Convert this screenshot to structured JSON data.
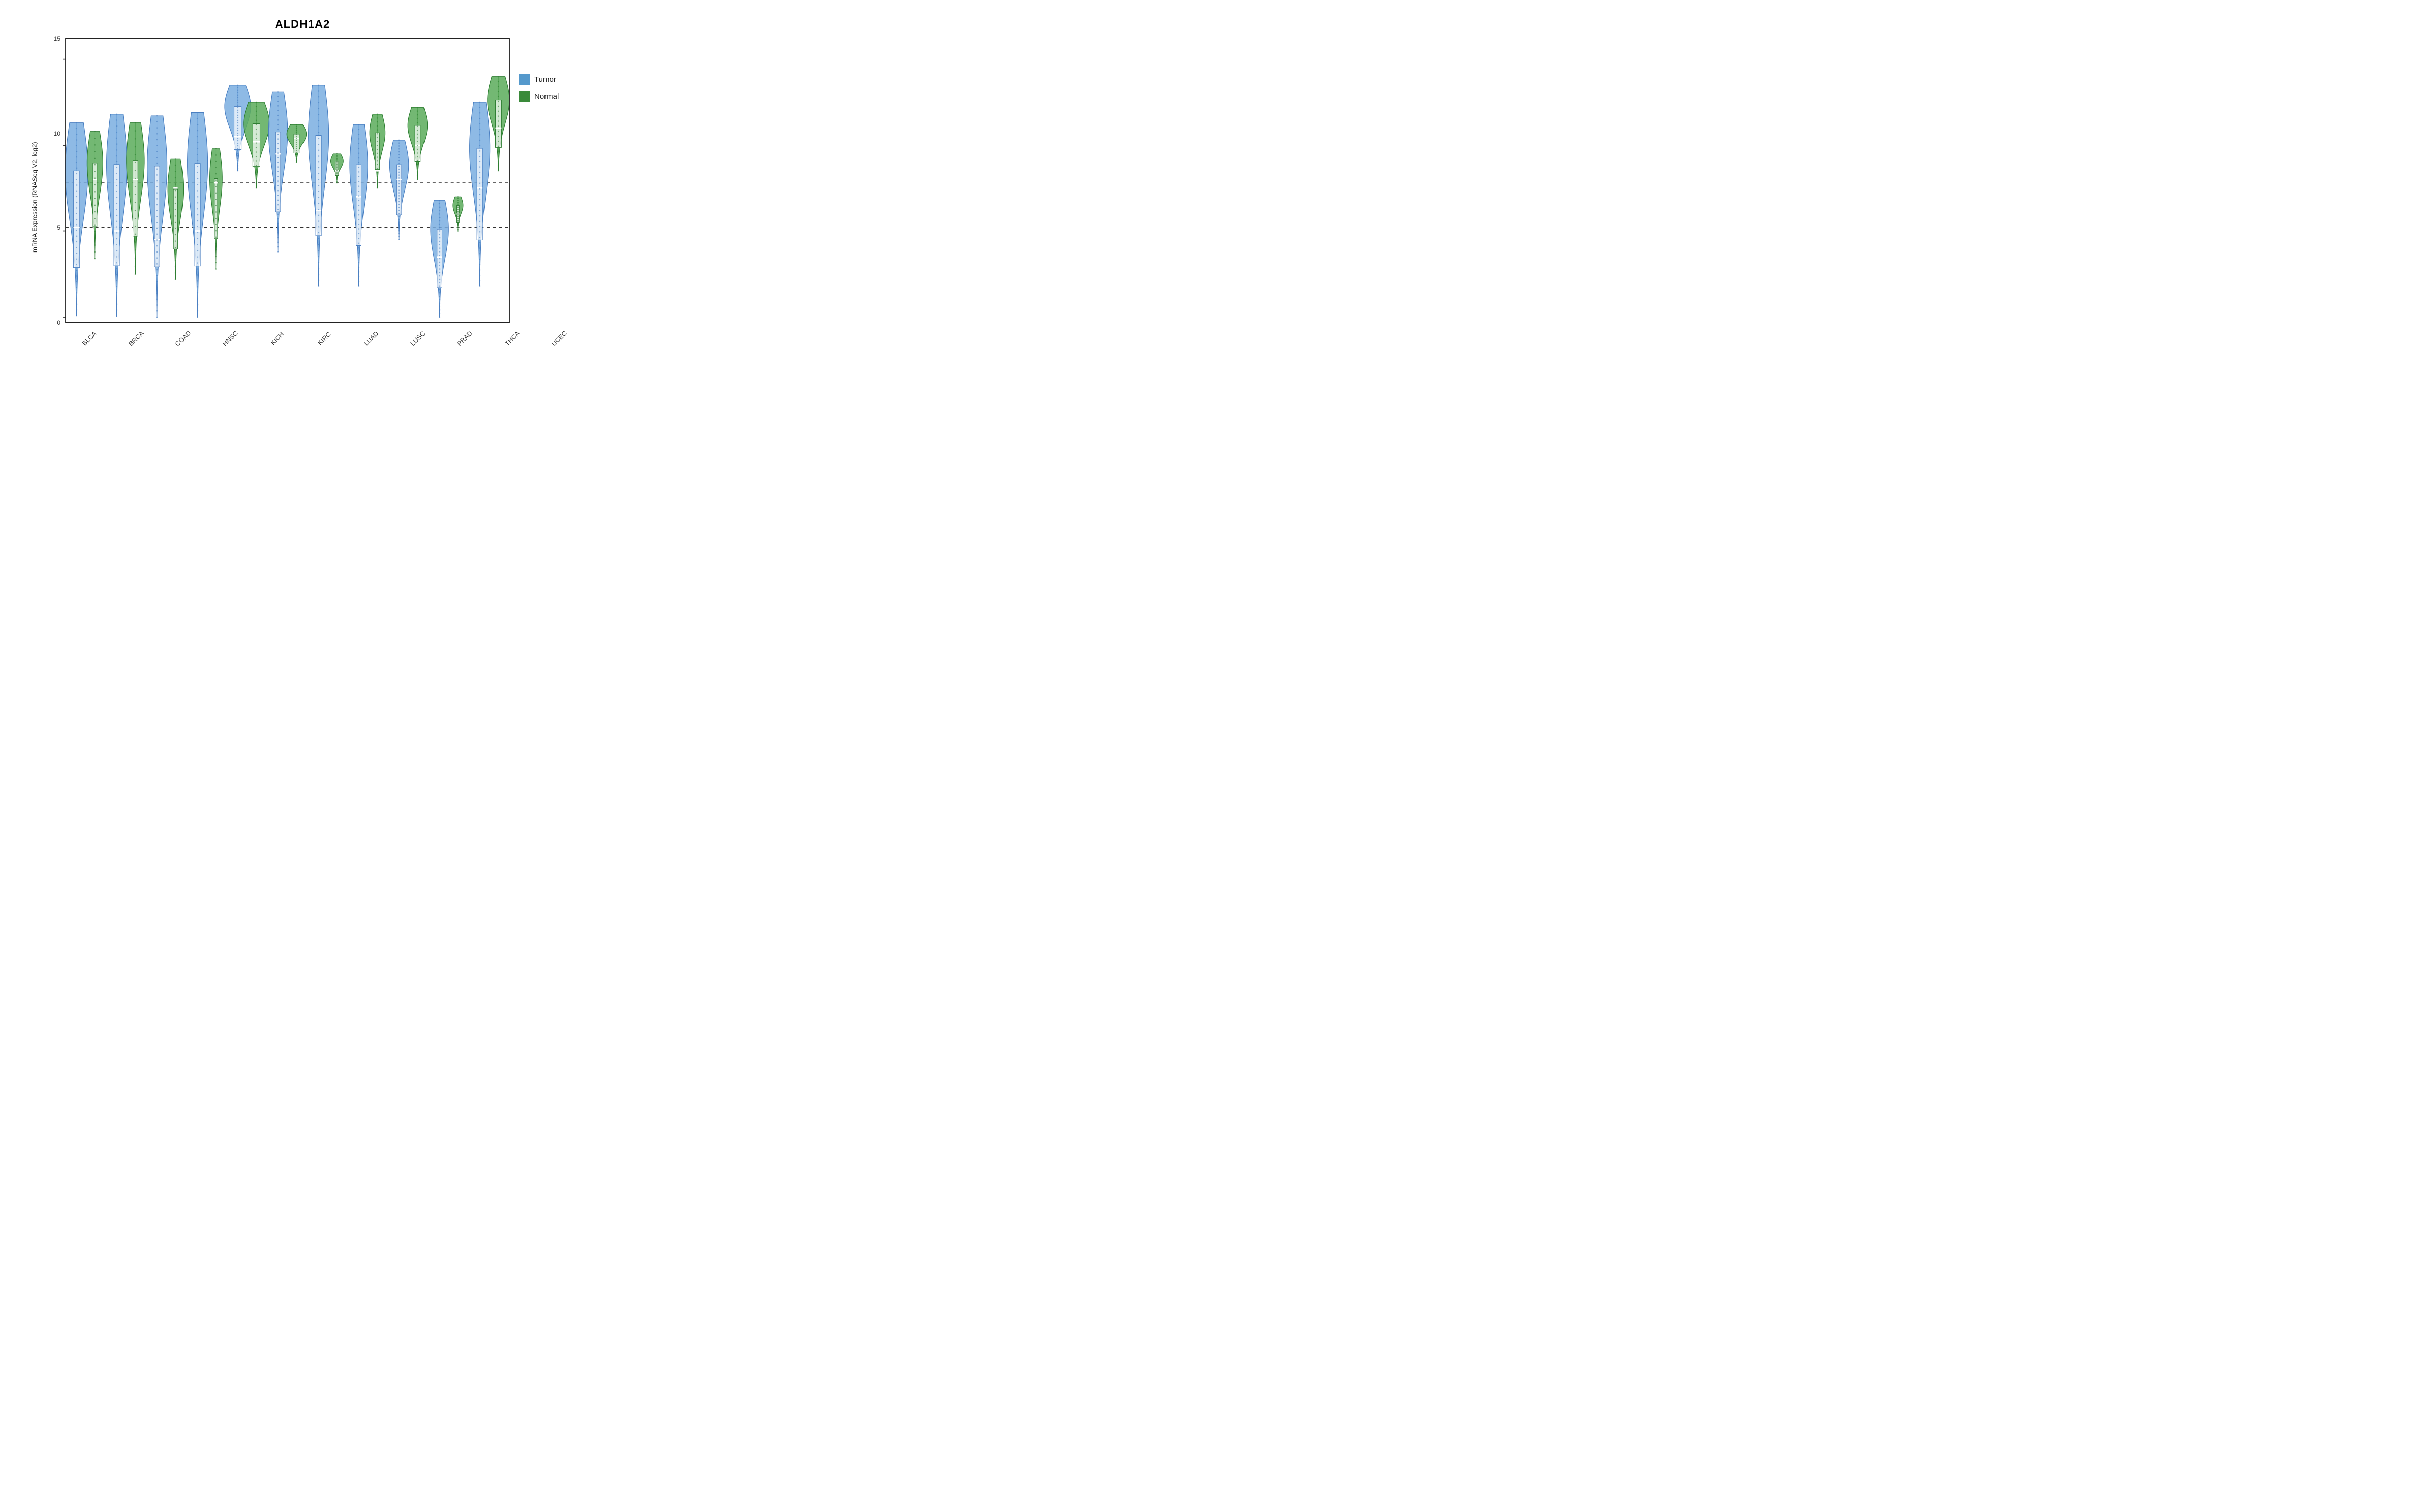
{
  "title": "ALDH1A2",
  "y_axis_label": "mRNA Expression (RNASeq V2, log2)",
  "y_ticks": [
    "15",
    "10",
    "5",
    "0"
  ],
  "x_labels": [
    "BLCA",
    "BRCA",
    "COAD",
    "HNSC",
    "KICH",
    "KIRC",
    "LUAD",
    "LUSC",
    "PRAD",
    "THCA",
    "UCEC"
  ],
  "dashed_lines_y": [
    7.8,
    5.2
  ],
  "legend": [
    {
      "label": "Tumor",
      "color": "#4a90d9"
    },
    {
      "label": "Normal",
      "color": "#4a9a3a"
    }
  ],
  "colors": {
    "tumor": "#5599cc",
    "tumor_fill": "#7bb8e8",
    "normal": "#3a8a3a",
    "normal_fill": "#5aaa5a",
    "dashed": "#333333",
    "axis": "#222222",
    "border": "#222222"
  },
  "violins": [
    {
      "name": "BLCA",
      "tumor": {
        "cx": 0.5,
        "ymin": 0.02,
        "ymax": 11.3,
        "ymid": 5.2,
        "width": 0.25,
        "dense_top": 7.5,
        "dense_bot": 4.5
      },
      "normal": {
        "cx": 1.1,
        "ymin": 3.4,
        "ymax": 10.8,
        "ymid": 8.0,
        "width": 0.18,
        "dense_top": 9.2,
        "dense_bot": 7.5
      }
    },
    {
      "name": "BRCA",
      "tumor": {
        "cx": 2.0,
        "ymin": 0.05,
        "ymax": 11.8,
        "ymid": 5.0,
        "width": 0.22
      },
      "normal": {
        "cx": 2.6,
        "ymin": 2.5,
        "ymax": 11.3,
        "ymid": 8.0,
        "width": 0.2
      }
    },
    {
      "name": "COAD",
      "tumor": {
        "cx": 3.5,
        "ymin": -0.1,
        "ymax": 11.7,
        "ymid": 4.5,
        "width": 0.22
      },
      "normal": {
        "cx": 4.0,
        "ymin": 2.2,
        "ymax": 9.2,
        "ymid": 7.5,
        "width": 0.17
      }
    },
    {
      "name": "HNSC",
      "tumor": {
        "cx": 5.0,
        "ymin": 0.0,
        "ymax": 11.9,
        "ymid": 5.0,
        "width": 0.22
      },
      "normal": {
        "cx": 5.5,
        "ymin": 2.8,
        "ymax": 9.8,
        "ymid": 7.8,
        "width": 0.15
      }
    },
    {
      "name": "KICH",
      "tumor": {
        "cx": 6.5,
        "ymin": 8.5,
        "ymax": 13.5,
        "ymid": 10.5,
        "width": 0.3
      },
      "normal": {
        "cx": 7.1,
        "ymin": 7.5,
        "ymax": 12.5,
        "ymid": 10.2,
        "width": 0.3
      }
    },
    {
      "name": "KIRC",
      "tumor": {
        "cx": 8.0,
        "ymin": 3.8,
        "ymax": 13.1,
        "ymid": 9.5,
        "width": 0.22
      },
      "normal": {
        "cx": 8.5,
        "ymin": 9.0,
        "ymax": 11.2,
        "ymid": 10.4,
        "width": 0.22
      }
    },
    {
      "name": "LUAD",
      "tumor": {
        "cx": 9.5,
        "ymin": 1.8,
        "ymax": 13.5,
        "ymid": 6.2,
        "width": 0.22
      },
      "normal": {
        "cx": 10.0,
        "ymin": 7.8,
        "ymax": 9.5,
        "ymid": 8.5,
        "width": 0.15
      }
    },
    {
      "name": "LUSC",
      "tumor": {
        "cx": 11.0,
        "ymin": 1.8,
        "ymax": 11.2,
        "ymid": 7.0,
        "width": 0.2
      },
      "normal": {
        "cx": 11.5,
        "ymin": 7.5,
        "ymax": 11.8,
        "ymid": 8.5,
        "width": 0.17
      }
    },
    {
      "name": "PRAD",
      "tumor": {
        "cx": 12.5,
        "ymin": 4.5,
        "ymax": 10.3,
        "ymid": 8.0,
        "width": 0.22
      },
      "normal": {
        "cx": 13.0,
        "ymin": 8.0,
        "ymax": 12.2,
        "ymid": 10.0,
        "width": 0.22
      }
    },
    {
      "name": "THCA",
      "tumor": {
        "cx": 14.0,
        "ymin": 0.0,
        "ymax": 6.8,
        "ymid": 3.5,
        "width": 0.2
      },
      "normal": {
        "cx": 14.5,
        "ymin": 5.0,
        "ymax": 7.0,
        "ymid": 6.0,
        "width": 0.12
      }
    },
    {
      "name": "UCEC",
      "tumor": {
        "cx": 15.5,
        "ymin": 1.8,
        "ymax": 12.5,
        "ymid": 7.5,
        "width": 0.22
      },
      "normal": {
        "cx": 16.0,
        "ymin": 8.5,
        "ymax": 14.0,
        "ymid": 11.0,
        "width": 0.25
      }
    }
  ]
}
